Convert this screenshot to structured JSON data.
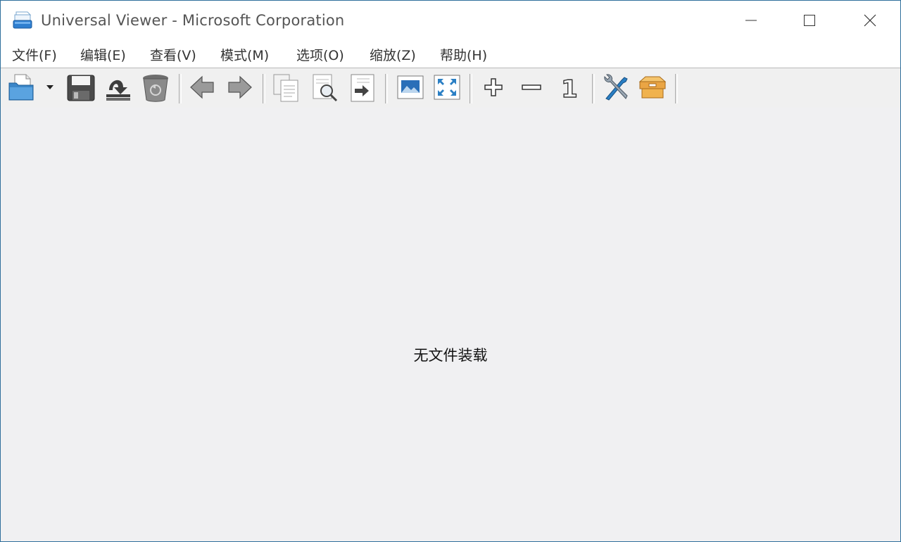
{
  "window": {
    "title": "Universal Viewer - Microsoft Corporation"
  },
  "menu": [
    {
      "label": "文件(F)"
    },
    {
      "label": "编辑(E)"
    },
    {
      "label": "查看(V)"
    },
    {
      "label": "模式(M)"
    },
    {
      "label": "选项(O)"
    },
    {
      "label": "缩放(Z)"
    },
    {
      "label": "帮助(H)"
    }
  ],
  "toolbar": {
    "zoom_original_label": "1",
    "icons": [
      "open-folder-icon",
      "dropdown-arrow-icon",
      "save-icon",
      "reload-icon",
      "recycle-bin-icon",
      "back-arrow-icon",
      "forward-arrow-icon",
      "copy-icon",
      "print-preview-icon",
      "export-icon",
      "image-fit-icon",
      "fullscreen-icon",
      "zoom-in-icon",
      "zoom-out-icon",
      "zoom-original-icon",
      "tools-icon",
      "plugin-box-icon"
    ]
  },
  "content": {
    "empty_message": "无文件装载"
  },
  "colors": {
    "border": "#2f6f9c",
    "content_bg": "#f0f0f2",
    "blue_icon": "#2a7fc4",
    "orange_icon": "#e8a23a"
  }
}
